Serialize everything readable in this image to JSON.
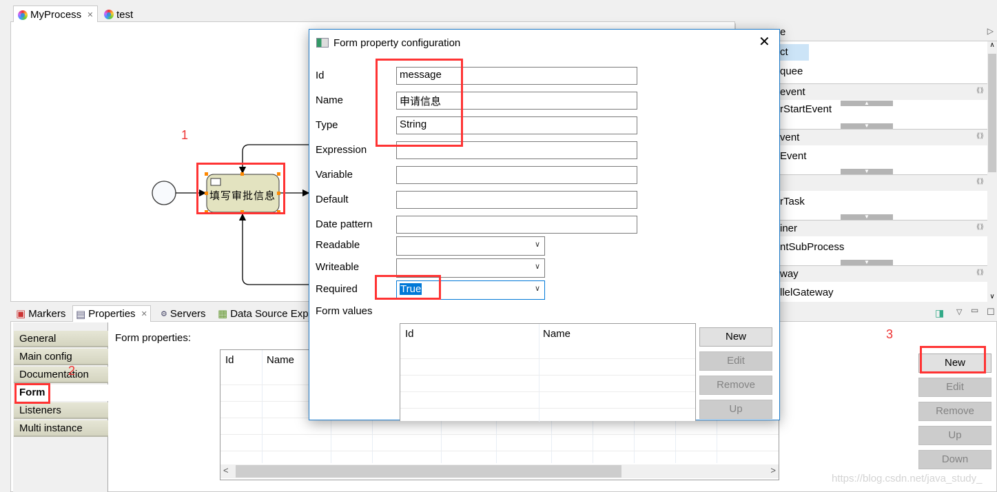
{
  "editor": {
    "tabs": [
      {
        "label": "MyProcess",
        "active": true,
        "closable": true
      },
      {
        "label": "test",
        "active": false
      }
    ],
    "diagram": {
      "task_label": "填写审批信息",
      "annotation_1": "1"
    }
  },
  "palette": {
    "header": "e",
    "items": [
      "ct",
      "quee"
    ],
    "drawers": [
      {
        "label": "event",
        "items": [
          "rStartEvent"
        ]
      },
      {
        "label": "vent",
        "items": [
          "Event"
        ]
      },
      {
        "label": "",
        "items": [
          "rTask"
        ]
      },
      {
        "label": "iner",
        "items": [
          "ntSubProcess"
        ]
      },
      {
        "label": "way",
        "items": [
          "llelGateway"
        ]
      }
    ]
  },
  "bottom": {
    "tabs": [
      "Markers",
      "Properties",
      "Servers",
      "Data Source Exp"
    ],
    "side_tabs": [
      "General",
      "Main config",
      "Documentation",
      "Form",
      "Listeners",
      "Multi instance"
    ],
    "selected_side_tab": "Form",
    "annotation_2": "2",
    "annotation_3": "3",
    "form_properties_label": "Form properties:",
    "table_columns": [
      "Id",
      "Name"
    ],
    "buttons": [
      {
        "label": "New",
        "enabled": true
      },
      {
        "label": "Edit",
        "enabled": false
      },
      {
        "label": "Remove",
        "enabled": false
      },
      {
        "label": "Up",
        "enabled": false
      },
      {
        "label": "Down",
        "enabled": false
      }
    ],
    "watermark": "https://blog.csdn.net/java_study_"
  },
  "dialog": {
    "title": "Form property configuration",
    "fields": {
      "id": {
        "label": "Id",
        "value": "message"
      },
      "name": {
        "label": "Name",
        "value": "申请信息"
      },
      "type": {
        "label": "Type",
        "value": "String"
      },
      "expression": {
        "label": "Expression",
        "value": ""
      },
      "variable": {
        "label": "Variable",
        "value": ""
      },
      "default": {
        "label": "Default",
        "value": ""
      },
      "date_pattern": {
        "label": "Date pattern",
        "value": ""
      },
      "readable": {
        "label": "Readable",
        "value": ""
      },
      "writeable": {
        "label": "Writeable",
        "value": ""
      },
      "required": {
        "label": "Required",
        "value": "True"
      }
    },
    "form_values_label": "Form values",
    "table_columns": [
      "Id",
      "Name"
    ],
    "buttons": [
      {
        "label": "New",
        "enabled": true
      },
      {
        "label": "Edit",
        "enabled": false
      },
      {
        "label": "Remove",
        "enabled": false
      },
      {
        "label": "Up",
        "enabled": false
      }
    ]
  },
  "colors": {
    "accent": "#0078d7",
    "annotation": "#ff3333",
    "task_fill": "#e3e3c0",
    "dialog_border": "#1979ca"
  }
}
